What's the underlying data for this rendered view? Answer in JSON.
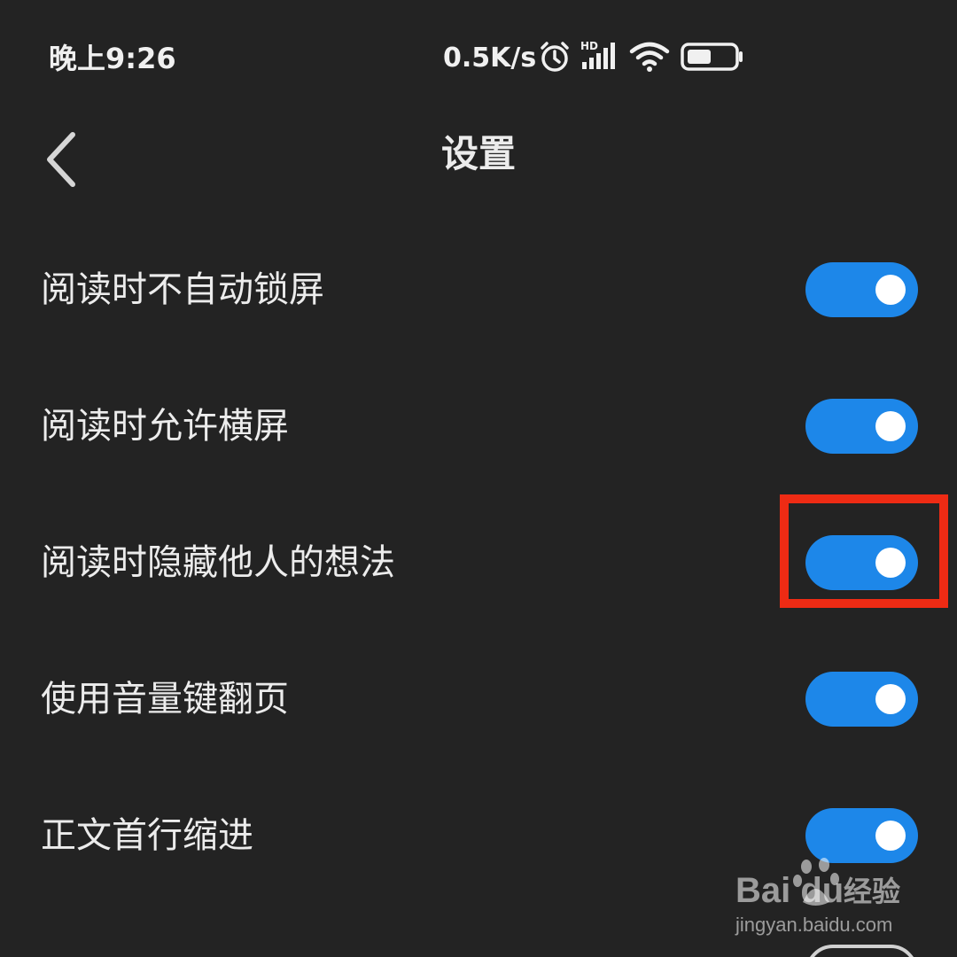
{
  "status_bar": {
    "time": "晚上9:26",
    "net_speed": "0.5K/s",
    "signal_label": "HD",
    "icons": [
      "alarm-icon",
      "signal-icon",
      "wifi-icon",
      "battery-icon"
    ]
  },
  "header": {
    "back_icon": "chevron-left-icon",
    "title": "设置"
  },
  "settings": [
    {
      "label": "阅读时不自动锁屏",
      "enabled": true
    },
    {
      "label": "阅读时允许横屏",
      "enabled": true
    },
    {
      "label": "阅读时隐藏他人的想法",
      "enabled": true
    },
    {
      "label": "使用音量键翻页",
      "enabled": true
    },
    {
      "label": "正文首行缩进",
      "enabled": true
    }
  ],
  "annotation": {
    "highlight_color": "#ee2b14",
    "target": "阅读时隐藏他人的想法"
  },
  "watermark": {
    "logo": "Bai du",
    "brand": "经验",
    "url": "jingyan.baidu.com"
  },
  "colors": {
    "background": "#232323",
    "toggle_on": "#1d87e9",
    "text": "#ececec"
  }
}
